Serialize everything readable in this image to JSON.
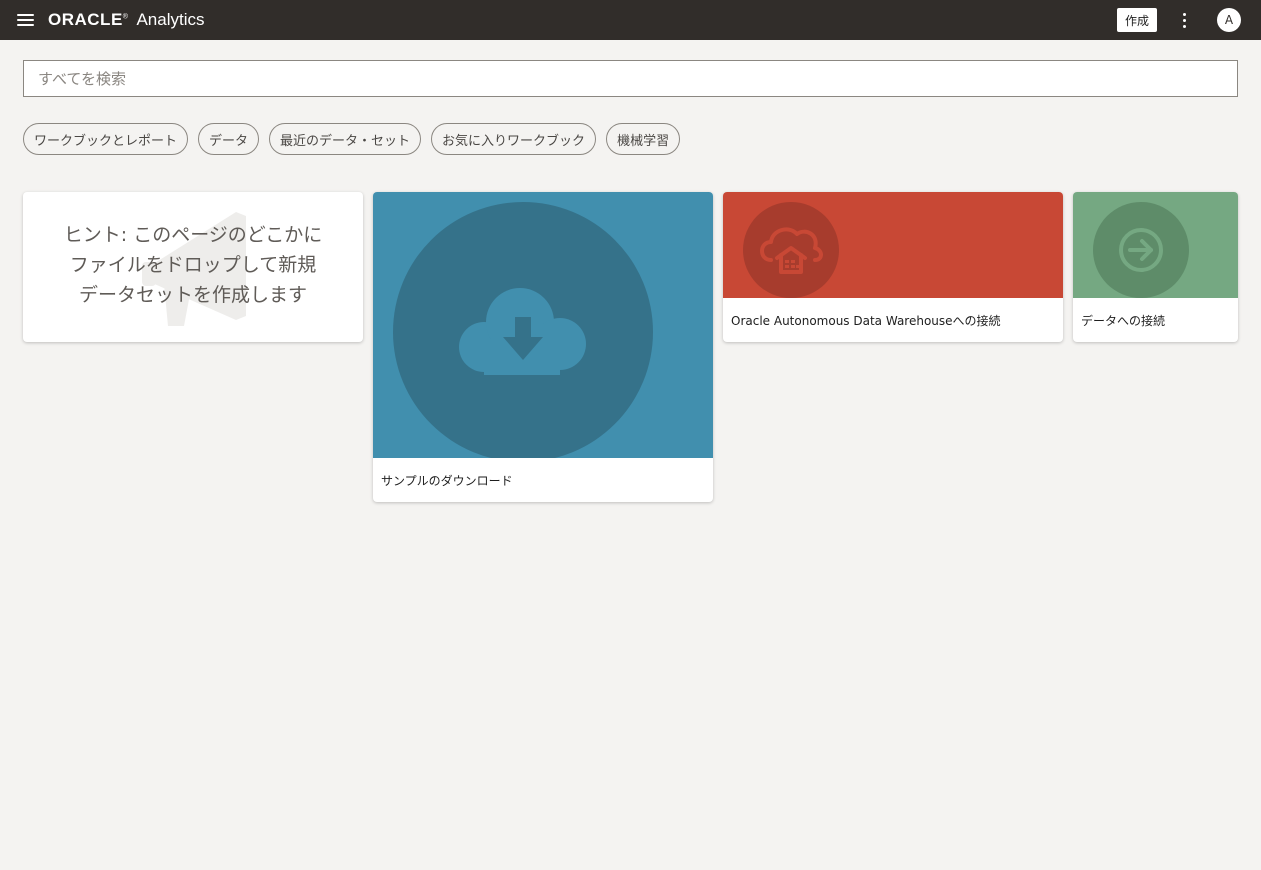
{
  "header": {
    "menu_icon": "hamburger-menu-icon",
    "logo_text": "ORACLE",
    "logo_mark": "®",
    "product_name": "Analytics",
    "create_label": "作成",
    "more_icon": "vertical-ellipsis-icon",
    "avatar_letter": "A"
  },
  "search": {
    "placeholder": "すべてを検索",
    "value": ""
  },
  "filters": [
    {
      "label": "ワークブックとレポート"
    },
    {
      "label": "データ"
    },
    {
      "label": "最近のデータ・セット"
    },
    {
      "label": "お気に入りワークブック"
    },
    {
      "label": "機械学習"
    }
  ],
  "cards": {
    "hint": {
      "line1": "ヒント: このページのどこかに",
      "line2": "ファイルをドロップして新規",
      "line3": "データセットを作成します",
      "icon": "megaphone-icon"
    },
    "sample": {
      "label": "サンプルのダウンロード",
      "icon": "cloud-download-icon",
      "color": "#418fae"
    },
    "adw": {
      "label": "Oracle Autonomous Data Warehouseへの接続",
      "icon": "cloud-warehouse-icon",
      "color": "#c84835"
    },
    "connect": {
      "label": "データへの接続",
      "icon": "arrow-circle-right-icon",
      "color": "#75a882"
    }
  }
}
